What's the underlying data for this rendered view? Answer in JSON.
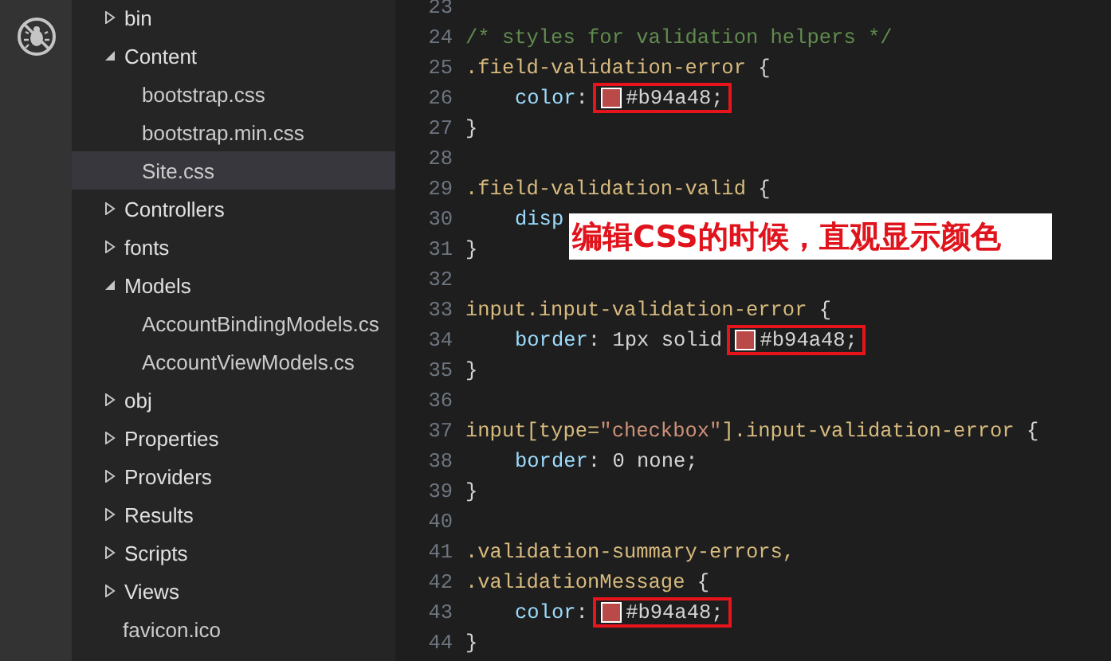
{
  "explorer": {
    "items": [
      {
        "kind": "folder",
        "label": "bin",
        "expanded": false,
        "selected": false
      },
      {
        "kind": "folder",
        "label": "Content",
        "expanded": true,
        "selected": false,
        "children": [
          {
            "kind": "file",
            "label": "bootstrap.css",
            "selected": false
          },
          {
            "kind": "file",
            "label": "bootstrap.min.css",
            "selected": false
          },
          {
            "kind": "file",
            "label": "Site.css",
            "selected": true
          }
        ]
      },
      {
        "kind": "folder",
        "label": "Controllers",
        "expanded": false,
        "selected": false
      },
      {
        "kind": "folder",
        "label": "fonts",
        "expanded": false,
        "selected": false
      },
      {
        "kind": "folder",
        "label": "Models",
        "expanded": true,
        "selected": false,
        "children": [
          {
            "kind": "file",
            "label": "AccountBindingModels.cs",
            "selected": false
          },
          {
            "kind": "file",
            "label": "AccountViewModels.cs",
            "selected": false
          }
        ]
      },
      {
        "kind": "folder",
        "label": "obj",
        "expanded": false,
        "selected": false
      },
      {
        "kind": "folder",
        "label": "Properties",
        "expanded": false,
        "selected": false
      },
      {
        "kind": "folder",
        "label": "Providers",
        "expanded": false,
        "selected": false
      },
      {
        "kind": "folder",
        "label": "Results",
        "expanded": false,
        "selected": false
      },
      {
        "kind": "folder",
        "label": "Scripts",
        "expanded": false,
        "selected": false
      },
      {
        "kind": "folder",
        "label": "Views",
        "expanded": false,
        "selected": false
      },
      {
        "kind": "file",
        "label": "favicon.ico",
        "selected": false
      }
    ]
  },
  "editor": {
    "lines": [
      {
        "number": "23"
      },
      {
        "number": "24",
        "tokens": [
          {
            "kind": "comment",
            "text": "/* styles for validation helpers */"
          }
        ]
      },
      {
        "number": "25",
        "tokens": [
          {
            "kind": "selector",
            "text": ".field-validation-error"
          },
          {
            "kind": "plain",
            "text": " {"
          }
        ]
      },
      {
        "number": "26",
        "indent": true,
        "tokens": [
          {
            "kind": "property",
            "text": "color"
          },
          {
            "kind": "plain",
            "text": ": "
          },
          {
            "kind": "swatch",
            "color": "#b94a48",
            "highlighted": true,
            "text": "#b94a48;"
          }
        ]
      },
      {
        "number": "27",
        "tokens": [
          {
            "kind": "plain",
            "text": "}"
          }
        ]
      },
      {
        "number": "28"
      },
      {
        "number": "29",
        "tokens": [
          {
            "kind": "selector",
            "text": ".field-validation-valid"
          },
          {
            "kind": "plain",
            "text": " {"
          }
        ]
      },
      {
        "number": "30",
        "indent": true,
        "tokens": [
          {
            "kind": "property",
            "text": "disp"
          }
        ]
      },
      {
        "number": "31",
        "tokens": [
          {
            "kind": "plain",
            "text": "}"
          }
        ]
      },
      {
        "number": "32"
      },
      {
        "number": "33",
        "tokens": [
          {
            "kind": "selector",
            "text": "input.input-validation-error"
          },
          {
            "kind": "plain",
            "text": " {"
          }
        ]
      },
      {
        "number": "34",
        "indent": true,
        "tokens": [
          {
            "kind": "property",
            "text": "border"
          },
          {
            "kind": "plain",
            "text": ": 1px solid "
          },
          {
            "kind": "swatch",
            "color": "#b94a48",
            "highlighted": true,
            "text": "#b94a48;"
          }
        ]
      },
      {
        "number": "35",
        "tokens": [
          {
            "kind": "plain",
            "text": "}"
          }
        ]
      },
      {
        "number": "36"
      },
      {
        "number": "37",
        "tokens": [
          {
            "kind": "selector",
            "text": "input[type="
          },
          {
            "kind": "string",
            "text": "\"checkbox\""
          },
          {
            "kind": "selector",
            "text": "].input-validation-error"
          },
          {
            "kind": "plain",
            "text": " {"
          }
        ]
      },
      {
        "number": "38",
        "indent": true,
        "tokens": [
          {
            "kind": "property",
            "text": "border"
          },
          {
            "kind": "plain",
            "text": ": 0 none;"
          }
        ]
      },
      {
        "number": "39",
        "tokens": [
          {
            "kind": "plain",
            "text": "}"
          }
        ]
      },
      {
        "number": "40"
      },
      {
        "number": "41",
        "tokens": [
          {
            "kind": "selector",
            "text": ".validation-summary-errors,"
          }
        ]
      },
      {
        "number": "42",
        "tokens": [
          {
            "kind": "selector",
            "text": ".validationMessage"
          },
          {
            "kind": "plain",
            "text": " {"
          }
        ]
      },
      {
        "number": "43",
        "indent": true,
        "tokens": [
          {
            "kind": "property",
            "text": "color"
          },
          {
            "kind": "plain",
            "text": ": "
          },
          {
            "kind": "swatch",
            "color": "#b94a48",
            "highlighted": true,
            "text": "#b94a48;"
          }
        ]
      },
      {
        "number": "44",
        "tokens": [
          {
            "kind": "plain",
            "text": "}"
          }
        ]
      }
    ]
  },
  "callout": {
    "text": "编辑CSS的时候，直观显示颜色"
  }
}
